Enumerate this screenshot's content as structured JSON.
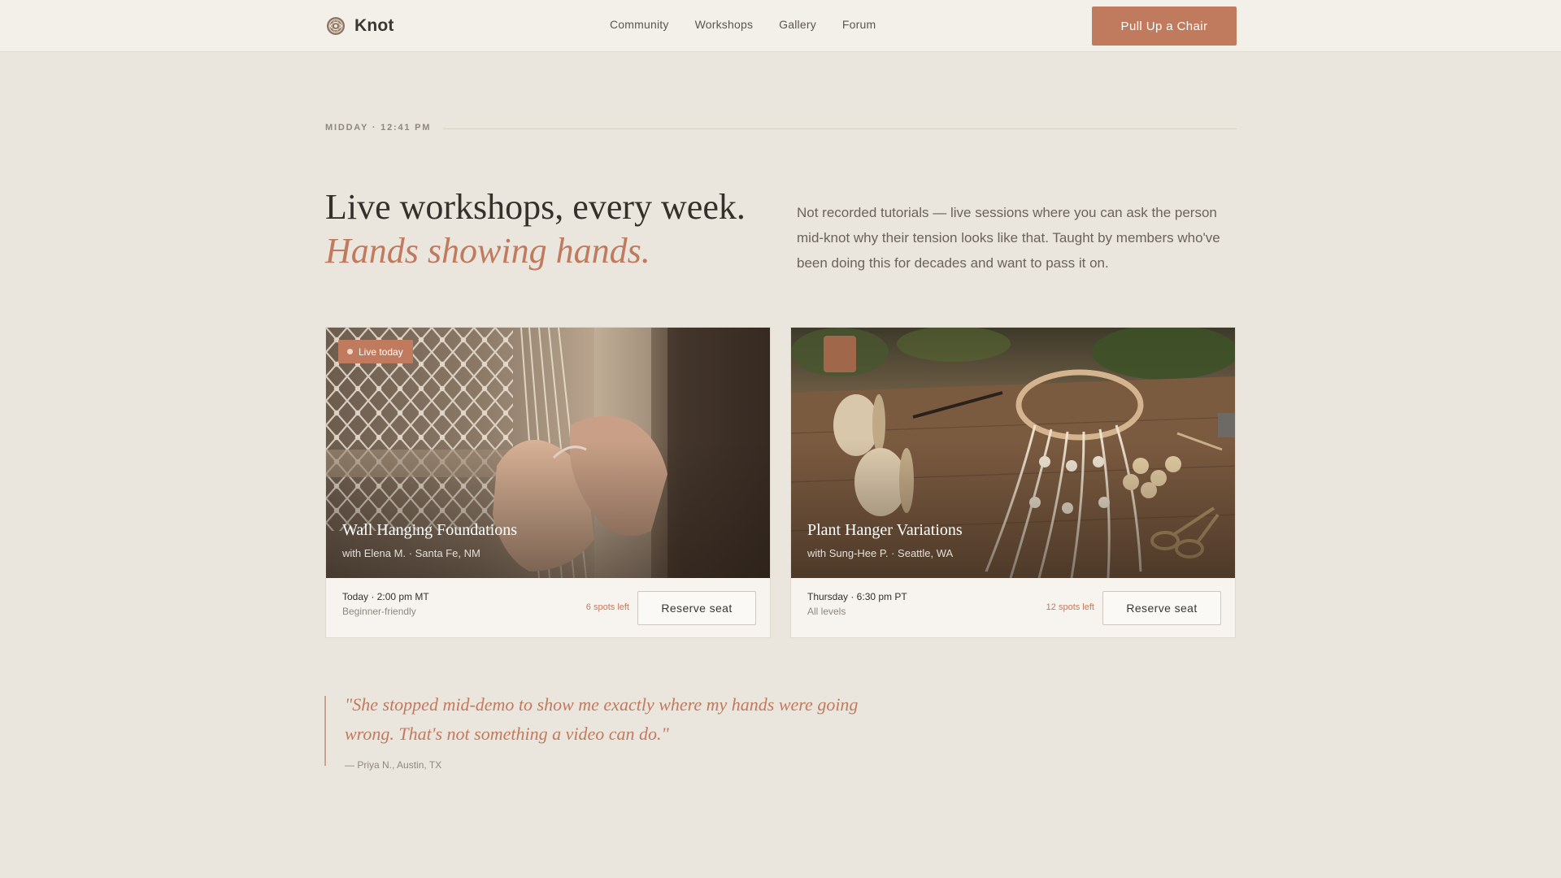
{
  "brand": {
    "name": "Knot"
  },
  "nav": {
    "items": [
      "Community",
      "Workshops",
      "Gallery",
      "Forum"
    ],
    "cta": "Pull Up a Chair"
  },
  "timestamp": "MIDDAY · 12:41 PM",
  "hero": {
    "title": "Live workshops, every week.",
    "subtitle": "Hands showing hands.",
    "description": "Not recorded tutorials — live sessions where you can ask the person mid-knot why their tension looks like that. Taught by members who've been doing this for decades and want to pass it on."
  },
  "workshops": [
    {
      "badge": "Live today",
      "title": "Wall Hanging Foundations",
      "host": "with Elena M. · Santa Fe, NM",
      "when": "Today · 2:00 pm MT",
      "level": "Beginner-friendly",
      "spots": "6 spots left",
      "button": "Reserve seat"
    },
    {
      "title": "Plant Hanger Variations",
      "host": "with Sung-Hee P. · Seattle, WA",
      "when": "Thursday · 6:30 pm PT",
      "level": "All levels",
      "spots": "12 spots left",
      "button": "Reserve seat"
    }
  ],
  "testimonial": {
    "quote": "\"She stopped mid-demo to show me exactly where my hands were going wrong. That's not something a video can do.\"",
    "author": "— Priya N., Austin, TX"
  },
  "colors": {
    "accent": "#c07a5e",
    "background": "#ebe6dd",
    "header": "#f3efe9",
    "text": "#34302c"
  }
}
